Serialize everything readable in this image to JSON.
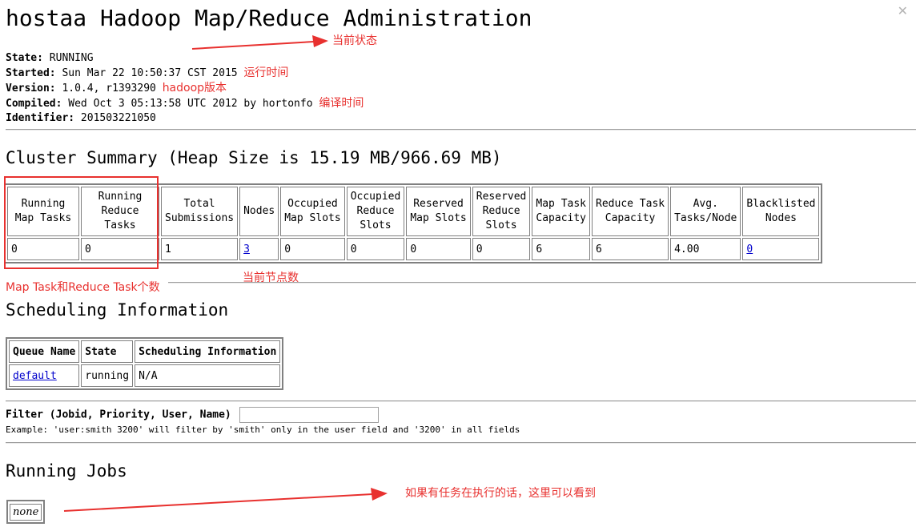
{
  "title": "hostaa Hadoop Map/Reduce Administration",
  "info": {
    "state_label": "State:",
    "state_value": "RUNNING",
    "started_label": "Started:",
    "started_value": "Sun Mar 22 10:50:37 CST 2015",
    "version_label": "Version:",
    "version_value": "1.0.4, r1393290",
    "compiled_label": "Compiled:",
    "compiled_value": "Wed Oct 3 05:13:58 UTC 2012 by hortonfo",
    "identifier_label": "Identifier:",
    "identifier_value": "201503221050"
  },
  "annotations": {
    "current_state": "当前状态",
    "run_time": "运行时间",
    "hadoop_version": "hadoop版本",
    "compile_time": "编译时间",
    "task_count": "Map Task和Reduce Task个数",
    "node_count": "当前节点数",
    "running_jobs_note": "如果有任务在执行的话，这里可以看到"
  },
  "cluster_summary": {
    "title": "Cluster Summary (Heap Size is 15.19 MB/966.69 MB)",
    "headers": [
      [
        "Running",
        "Map Tasks"
      ],
      [
        "Running",
        "Reduce",
        "Tasks"
      ],
      [
        "Total",
        "Submissions"
      ],
      [
        "Nodes"
      ],
      [
        "Occupied",
        "Map Slots"
      ],
      [
        "Occupied",
        "Reduce",
        "Slots"
      ],
      [
        "Reserved",
        "Map Slots"
      ],
      [
        "Reserved",
        "Reduce",
        "Slots"
      ],
      [
        "Map Task",
        "Capacity"
      ],
      [
        "Reduce Task",
        "Capacity"
      ],
      [
        "Avg.",
        "Tasks/Node"
      ],
      [
        "Blacklisted",
        "Nodes"
      ]
    ],
    "values": [
      "0",
      "0",
      "1",
      "3",
      "0",
      "0",
      "0",
      "0",
      "6",
      "6",
      "4.00",
      "0"
    ]
  },
  "scheduling": {
    "title": "Scheduling Information",
    "headers": [
      "Queue Name",
      "State",
      "Scheduling Information"
    ],
    "rows": [
      {
        "queue": "default",
        "state": "running",
        "info": "N/A"
      }
    ]
  },
  "filter": {
    "label": "Filter (Jobid, Priority, User, Name)",
    "value": "",
    "example": "Example: 'user:smith 3200' will filter by 'smith' only in the user field and '3200' in all fields"
  },
  "running_jobs": {
    "title": "Running Jobs",
    "empty_text": "none"
  },
  "colors": {
    "annotation": "#e8312f",
    "link": "#0000cc",
    "border": "#808080"
  }
}
